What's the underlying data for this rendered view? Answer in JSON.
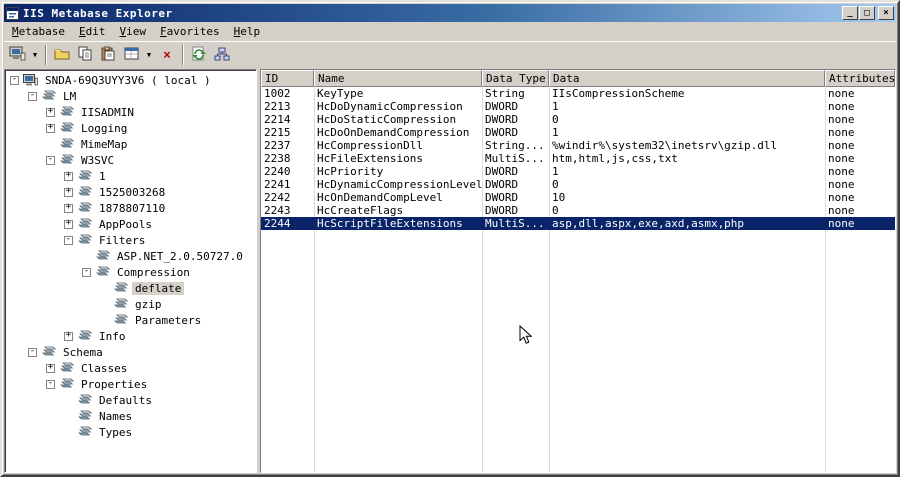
{
  "window": {
    "title": "IIS Metabase Explorer",
    "controls": {
      "minimize": "_",
      "maximize": "□",
      "close": "×"
    }
  },
  "colors": {
    "window_bg": "#d4d0c8",
    "selection_bg": "#0a246a",
    "titlebar_gradient_start": "#0a246a",
    "titlebar_gradient_end": "#a6caf0"
  },
  "menu": {
    "items": [
      {
        "label": "Metabase"
      },
      {
        "label": "Edit"
      },
      {
        "label": "View"
      },
      {
        "label": "Favorites"
      },
      {
        "label": "Help"
      }
    ]
  },
  "toolbar": {
    "buttons": [
      "connect-computer",
      "new-key",
      "copy",
      "paste",
      "data-record",
      "delete",
      "refresh",
      "security-tree"
    ],
    "delete_glyph": "×",
    "dropdown_glyph": "▼"
  },
  "tree": {
    "nodes": [
      {
        "label": "SNDA-69Q3UYY3V6 ( local )",
        "level": 0,
        "expand": "minus",
        "icon": "computer",
        "selected": false
      },
      {
        "label": "LM",
        "level": 1,
        "expand": "minus",
        "icon": "key",
        "selected": false
      },
      {
        "label": "IISADMIN",
        "level": 2,
        "expand": "plus",
        "icon": "key",
        "selected": false
      },
      {
        "label": "Logging",
        "level": 2,
        "expand": "plus",
        "icon": "key",
        "selected": false
      },
      {
        "label": "MimeMap",
        "level": 2,
        "expand": "none",
        "icon": "key",
        "selected": false
      },
      {
        "label": "W3SVC",
        "level": 2,
        "expand": "minus",
        "icon": "key",
        "selected": false
      },
      {
        "label": "1",
        "level": 3,
        "expand": "plus",
        "icon": "key",
        "selected": false
      },
      {
        "label": "1525003268",
        "level": 3,
        "expand": "plus",
        "icon": "key",
        "selected": false
      },
      {
        "label": "1878807110",
        "level": 3,
        "expand": "plus",
        "icon": "key",
        "selected": false
      },
      {
        "label": "AppPools",
        "level": 3,
        "expand": "plus",
        "icon": "key",
        "selected": false
      },
      {
        "label": "Filters",
        "level": 3,
        "expand": "minus",
        "icon": "key",
        "selected": false
      },
      {
        "label": "ASP.NET_2.0.50727.0",
        "level": 4,
        "expand": "none",
        "icon": "key",
        "selected": false
      },
      {
        "label": "Compression",
        "level": 4,
        "expand": "minus",
        "icon": "key",
        "selected": false
      },
      {
        "label": "deflate",
        "level": 5,
        "expand": "none",
        "icon": "key",
        "selected": true
      },
      {
        "label": "gzip",
        "level": 5,
        "expand": "none",
        "icon": "key",
        "selected": false
      },
      {
        "label": "Parameters",
        "level": 5,
        "expand": "none",
        "icon": "key",
        "selected": false
      },
      {
        "label": "Info",
        "level": 3,
        "expand": "plus",
        "icon": "key",
        "selected": false
      },
      {
        "label": "Schema",
        "level": 1,
        "expand": "minus",
        "icon": "key",
        "selected": false
      },
      {
        "label": "Classes",
        "level": 2,
        "expand": "plus",
        "icon": "key",
        "selected": false
      },
      {
        "label": "Properties",
        "level": 2,
        "expand": "minus",
        "icon": "key",
        "selected": false
      },
      {
        "label": "Defaults",
        "level": 3,
        "expand": "none",
        "icon": "key",
        "selected": false
      },
      {
        "label": "Names",
        "level": 3,
        "expand": "none",
        "icon": "key",
        "selected": false
      },
      {
        "label": "Types",
        "level": 3,
        "expand": "none",
        "icon": "key",
        "selected": false
      }
    ]
  },
  "list": {
    "columns": [
      {
        "label": "ID"
      },
      {
        "label": "Name"
      },
      {
        "label": "Data Type"
      },
      {
        "label": "Data"
      },
      {
        "label": "Attributes"
      }
    ],
    "rows": [
      {
        "id": "1002",
        "name": "KeyType",
        "type": "String",
        "data": "IIsCompressionScheme",
        "attributes": "none",
        "selected": false
      },
      {
        "id": "2213",
        "name": "HcDoDynamicCompression",
        "type": "DWORD",
        "data": "1",
        "attributes": "none",
        "selected": false
      },
      {
        "id": "2214",
        "name": "HcDoStaticCompression",
        "type": "DWORD",
        "data": "0",
        "attributes": "none",
        "selected": false
      },
      {
        "id": "2215",
        "name": "HcDoOnDemandCompression",
        "type": "DWORD",
        "data": "1",
        "attributes": "none",
        "selected": false
      },
      {
        "id": "2237",
        "name": "HcCompressionDll",
        "type": "String...",
        "data": "%windir%\\system32\\inetsrv\\gzip.dll",
        "attributes": "none",
        "selected": false
      },
      {
        "id": "2238",
        "name": "HcFileExtensions",
        "type": "MultiS...",
        "data": "htm,html,js,css,txt",
        "attributes": "none",
        "selected": false
      },
      {
        "id": "2240",
        "name": "HcPriority",
        "type": "DWORD",
        "data": "1",
        "attributes": "none",
        "selected": false
      },
      {
        "id": "2241",
        "name": "HcDynamicCompressionLevel",
        "type": "DWORD",
        "data": "0",
        "attributes": "none",
        "selected": false
      },
      {
        "id": "2242",
        "name": "HcOnDemandCompLevel",
        "type": "DWORD",
        "data": "10",
        "attributes": "none",
        "selected": false
      },
      {
        "id": "2243",
        "name": "HcCreateFlags",
        "type": "DWORD",
        "data": "0",
        "attributes": "none",
        "selected": false
      },
      {
        "id": "2244",
        "name": "HcScriptFileExtensions",
        "type": "MultiS...",
        "data": "asp,dll,aspx,exe,axd,asmx,php",
        "attributes": "none",
        "selected": true
      }
    ]
  }
}
